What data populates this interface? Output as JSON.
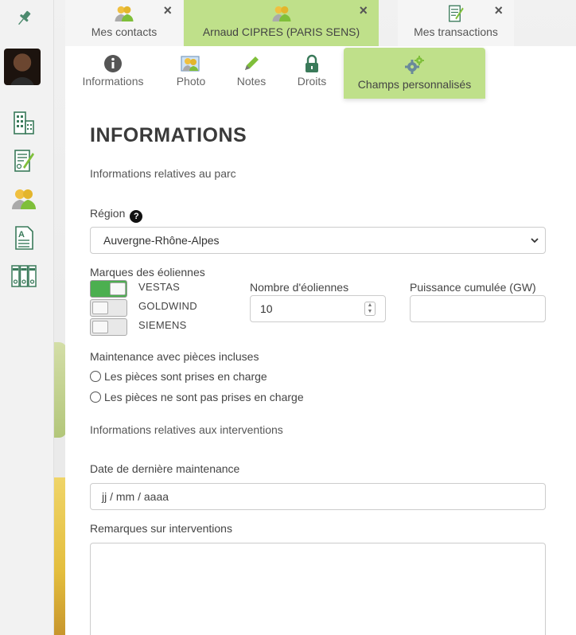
{
  "tabs": [
    {
      "label": "Mes contacts",
      "icon": "contacts-icon",
      "active": false
    },
    {
      "label": "Arnaud CIPRES (PARIS SENS)",
      "icon": "contacts-icon",
      "active": true
    },
    {
      "label": "Mes transactions",
      "icon": "transaction-doc-icon",
      "active": false
    }
  ],
  "sidebar": {
    "items": [
      "pin-icon",
      "avatar",
      "building-icon",
      "contract-doc-icon",
      "contacts-icon",
      "document-icon",
      "archive-binders-icon"
    ]
  },
  "subtabs": [
    {
      "label": "Informations",
      "icon": "info-icon"
    },
    {
      "label": "Photo",
      "icon": "photo-people-icon"
    },
    {
      "label": "Notes",
      "icon": "pencil-icon"
    },
    {
      "label": "Droits",
      "icon": "lock-icon"
    },
    {
      "label": "Champs personnalisés",
      "icon": "gears-icon",
      "active": true
    }
  ],
  "main": {
    "title": "INFORMATIONS",
    "section1": "Informations relatives au parc",
    "region_label": "Région",
    "region_value": "Auvergne-Rhône-Alpes",
    "brands_label": "Marques des éoliennes",
    "brands": [
      {
        "label": "VESTAS",
        "on": true
      },
      {
        "label": "GOLDWIND",
        "on": false
      },
      {
        "label": "SIEMENS",
        "on": false
      }
    ],
    "count_label": "Nombre d'éoliennes",
    "count_value": "10",
    "power_label": "Puissance cumulée (GW)",
    "power_value": "",
    "maintenance_label": "Maintenance avec pièces incluses",
    "maintenance_options": [
      "Les pièces sont prises en charge",
      "Les pièces ne sont pas prises en charge"
    ],
    "section2": "Informations relatives aux interventions",
    "date_label": "Date de dernière maintenance",
    "date_placeholder": "jj / mm / aaaa",
    "remarks_label": "Remarques sur interventions",
    "remarks_value": ""
  },
  "colors": {
    "active_tab": "#bfe08a",
    "toggle_on": "#4caf50"
  }
}
